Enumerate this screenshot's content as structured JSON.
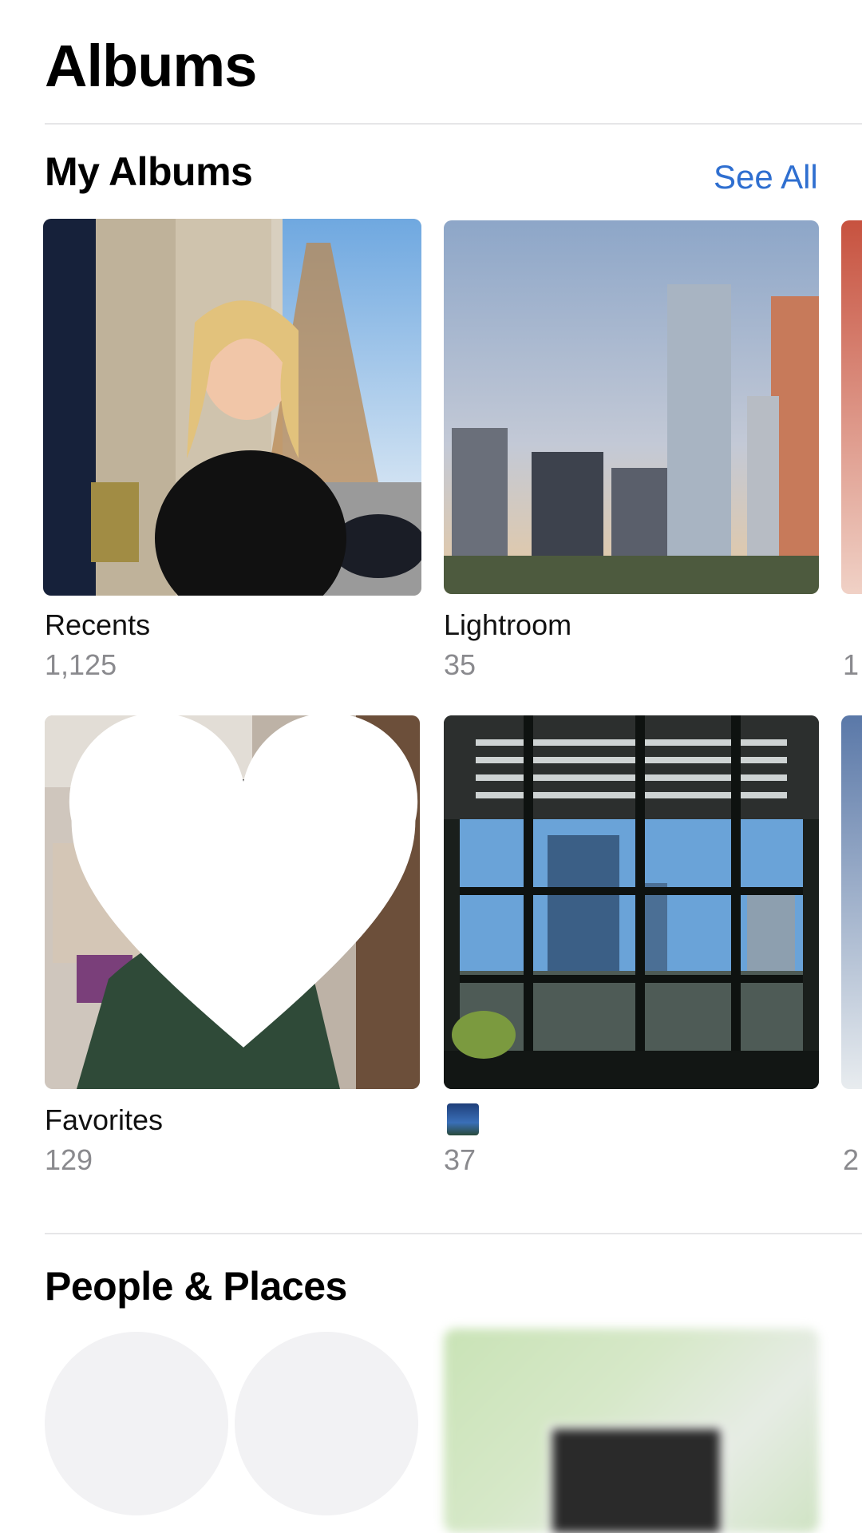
{
  "header": {
    "title": "Albums"
  },
  "my_albums": {
    "title": "My Albums",
    "see_all_label": "See All",
    "albums": [
      {
        "name": "Recents",
        "count": "1,125"
      },
      {
        "name": "Lightroom",
        "count": "35"
      },
      {
        "name": "Favorites",
        "count": "129"
      },
      {
        "name": "",
        "name_icon": "city-photo-thumbnail",
        "count": "37"
      }
    ],
    "partial_third_column": [
      {
        "count": "1"
      },
      {
        "count": "2"
      }
    ]
  },
  "people_places": {
    "title": "People & Places"
  },
  "colors": {
    "accent": "#2f6fd0",
    "secondary_text": "#8a8a8e"
  }
}
